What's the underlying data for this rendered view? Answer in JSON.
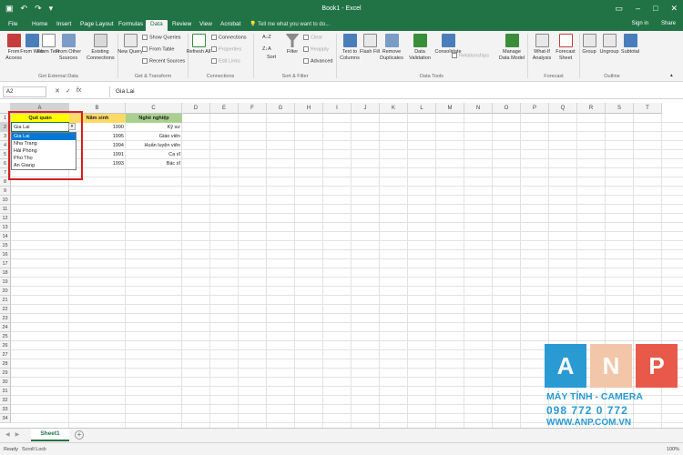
{
  "app": {
    "title": "Book1 - Excel"
  },
  "colors": {
    "excel_green": "#217346",
    "header_yellow": "#ffff00",
    "header_orange": "#ffd966",
    "header_green": "#a9d08e",
    "selection_blue": "#0078d7",
    "highlight_red": "#d81e1e",
    "watermark_blue": "#2a9ad3"
  },
  "tabs": [
    "File",
    "Home",
    "Insert",
    "Page Layout",
    "Formulas",
    "Data",
    "Review",
    "View",
    "Acrobat"
  ],
  "active_tab": "Data",
  "tell_me": "Tell me what you want to do...",
  "sign_in": "Sign in",
  "share": "Share",
  "ribbon": {
    "get_external_data": {
      "label": "Get External Data",
      "buttons": [
        "From Access",
        "From Web",
        "From Text",
        "From Other Sources",
        "Existing Connections"
      ]
    },
    "get_transform": {
      "label": "Get & Transform",
      "new_query": "New Query",
      "show_queries": "Show Queries",
      "from_table": "From Table",
      "recent_sources": "Recent Sources"
    },
    "connections": {
      "label": "Connections",
      "refresh_all": "Refresh All",
      "connections": "Connections",
      "properties": "Properties",
      "edit_links": "Edit Links"
    },
    "sort_filter": {
      "label": "Sort & Filter",
      "sort": "Sort",
      "filter": "Filter",
      "clear": "Clear",
      "reapply": "Reapply",
      "advanced": "Advanced"
    },
    "data_tools": {
      "label": "Data Tools",
      "text_to_columns": "Text to Columns",
      "flash_fill": "Flash Fill",
      "remove_duplicates": "Remove Duplicates",
      "data_validation": "Data Validation",
      "consolidate": "Consolidate",
      "relationships": "Relationships",
      "manage_data_model": "Manage Data Model"
    },
    "forecast": {
      "label": "Forecast",
      "what_if": "What-If Analysis",
      "forecast_sheet": "Forecast Sheet"
    },
    "outline": {
      "label": "Outline",
      "group": "Group",
      "ungroup": "Ungroup",
      "subtotal": "Subtotal"
    }
  },
  "name_box": "A2",
  "formula_value": "Gia Lai",
  "columns": [
    "A",
    "B",
    "C",
    "D",
    "E",
    "F",
    "G",
    "H",
    "I",
    "J",
    "K",
    "L",
    "M",
    "N",
    "O",
    "P",
    "Q",
    "R",
    "S",
    "T"
  ],
  "rows": [
    "1",
    "2",
    "3",
    "4",
    "5",
    "6",
    "7",
    "8",
    "9",
    "10",
    "11",
    "12",
    "13",
    "14",
    "15",
    "16",
    "17",
    "18",
    "19",
    "20",
    "21",
    "22",
    "23",
    "24",
    "25",
    "26",
    "27",
    "28",
    "29",
    "30",
    "31",
    "32",
    "33",
    "34"
  ],
  "table": {
    "headers": [
      "Quê quán",
      "Năm sinh",
      "Nghề nghiệp"
    ],
    "a_values": [
      "Gia Lai",
      "",
      "",
      "",
      "An Giang"
    ],
    "b_values": [
      "1990",
      "1995",
      "1994",
      "1991",
      "1993"
    ],
    "c_values": [
      "Kỹ sư",
      "Giáo viên",
      "Huấn luyện viên",
      "Ca sĩ",
      "Bác sĩ"
    ]
  },
  "dropdown": {
    "options": [
      "Gia Lai",
      "Nha Trang",
      "Hải Phòng",
      "Phú Thọ",
      "An Giang"
    ],
    "selected": "Gia Lai"
  },
  "sheet_tab": "Sheet1",
  "status": {
    "ready": "Ready",
    "scroll_lock": "Scroll Lock",
    "zoom": "100%"
  },
  "watermark": {
    "letters": [
      "A",
      "N",
      "P"
    ],
    "line1": "MÁY TÍNH - CAMERA",
    "phone": "098 772 0 772",
    "url": "WWW.ANP.COM.VN"
  }
}
